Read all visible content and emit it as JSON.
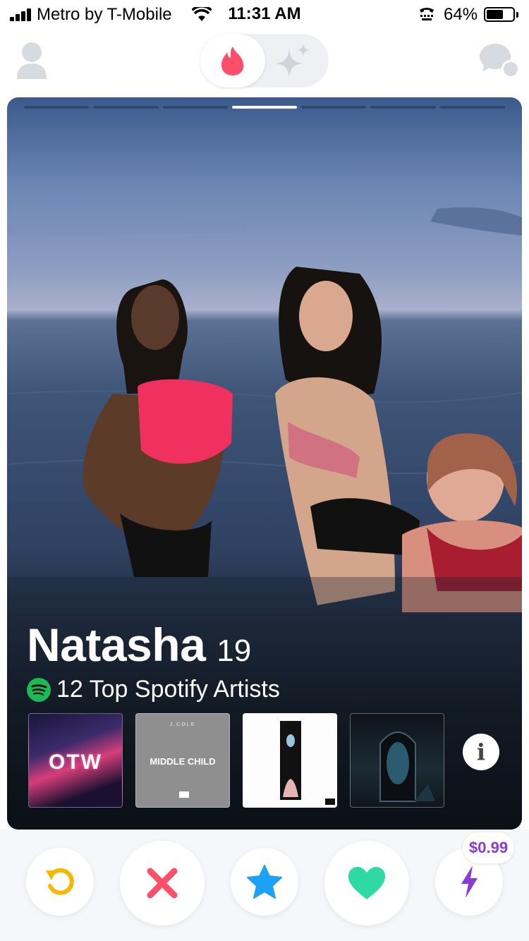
{
  "status_bar": {
    "carrier": "Metro by T-Mobile",
    "time": "11:31 AM",
    "battery_percent": "64%",
    "battery_level": 0.64
  },
  "nav": {
    "icons": [
      "profile-icon",
      "flame-icon",
      "sparkle-icon",
      "chat-icon"
    ]
  },
  "card": {
    "photo_count": 7,
    "active_photo_index": 3,
    "name": "Natasha",
    "age": "19",
    "spotify_text": "12 Top Spotify Artists",
    "albums": [
      {
        "title_text": "OTW"
      },
      {
        "header_text": "J.COLE",
        "title_text": "MIDDLE CHILD"
      },
      {
        "title_text": ""
      },
      {
        "title_text": ""
      }
    ],
    "info_label": "i"
  },
  "actions": {
    "boost_price": "$0.99",
    "colors": {
      "rewind": "#f5b700",
      "nope": "#fd5068",
      "star": "#1ea1f2",
      "like": "#2ed9a4",
      "boost": "#8a3bd6"
    }
  }
}
